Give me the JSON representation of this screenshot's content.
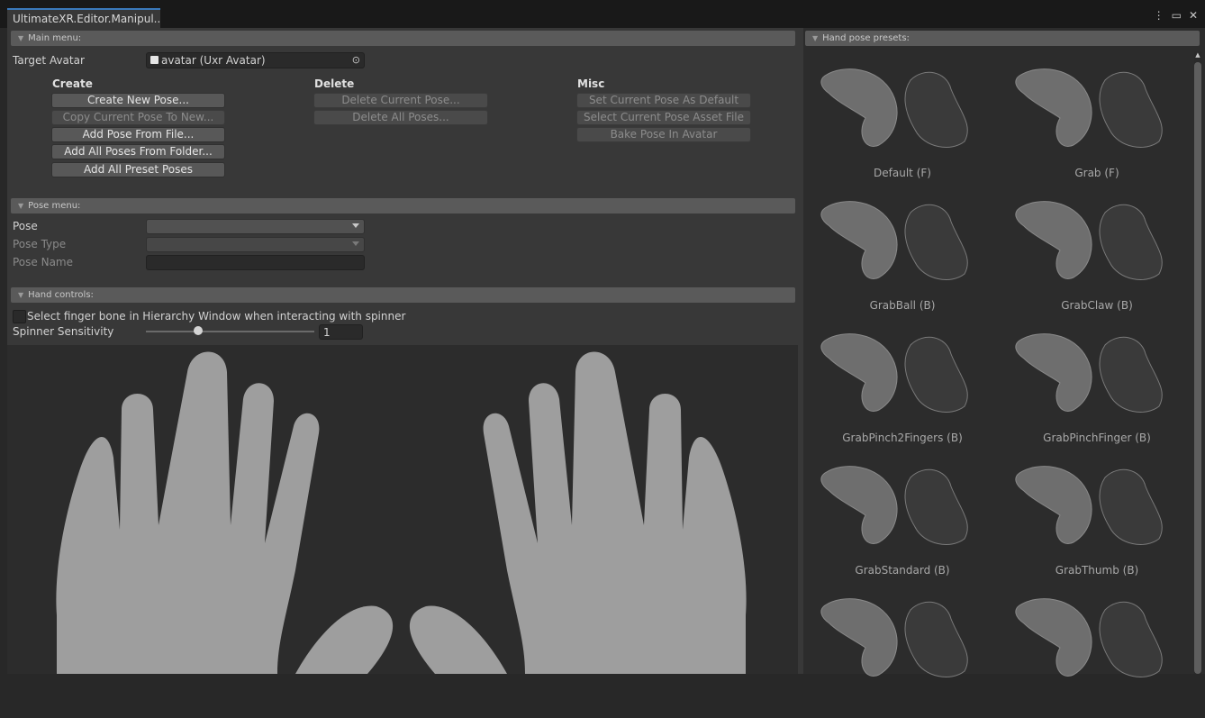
{
  "window": {
    "tab_title": "UltimateXR.Editor.Manipul..."
  },
  "main_menu": {
    "header": "Main menu:",
    "target_avatar_label": "Target Avatar",
    "target_avatar_value": "avatar (Uxr Avatar)",
    "create": {
      "title": "Create",
      "buttons": [
        "Create New Pose...",
        "Copy Current Pose To New...",
        "Add Pose From File...",
        "Add All Poses From Folder...",
        "Add All Preset Poses"
      ]
    },
    "delete": {
      "title": "Delete",
      "buttons": [
        "Delete Current Pose...",
        "Delete All Poses..."
      ]
    },
    "misc": {
      "title": "Misc",
      "buttons": [
        "Set Current Pose As Default",
        "Select Current Pose Asset File",
        "Bake Pose In Avatar"
      ]
    }
  },
  "pose_menu": {
    "header": "Pose menu:",
    "pose_label": "Pose",
    "pose_type_label": "Pose Type",
    "pose_name_label": "Pose Name"
  },
  "hand_controls": {
    "header": "Hand controls:",
    "toggle_label": "Select finger bone in Hierarchy Window when interacting with spinner",
    "sensitivity_label": "Spinner Sensitivity",
    "sensitivity_value": "1",
    "sensitivity_level": 0.31
  },
  "presets": {
    "header": "Hand pose presets:",
    "items": [
      "Default (F)",
      "Grab (F)",
      "GrabBall (B)",
      "GrabClaw (B)",
      "GrabPinch2Fingers (B)",
      "GrabPinchFinger (B)",
      "GrabStandard (B)",
      "GrabThumb (B)",
      "",
      ""
    ]
  },
  "colors": {
    "accent": "#3a79bb",
    "hand_silhouette": "#9e9e9e",
    "panel": "#383838"
  }
}
